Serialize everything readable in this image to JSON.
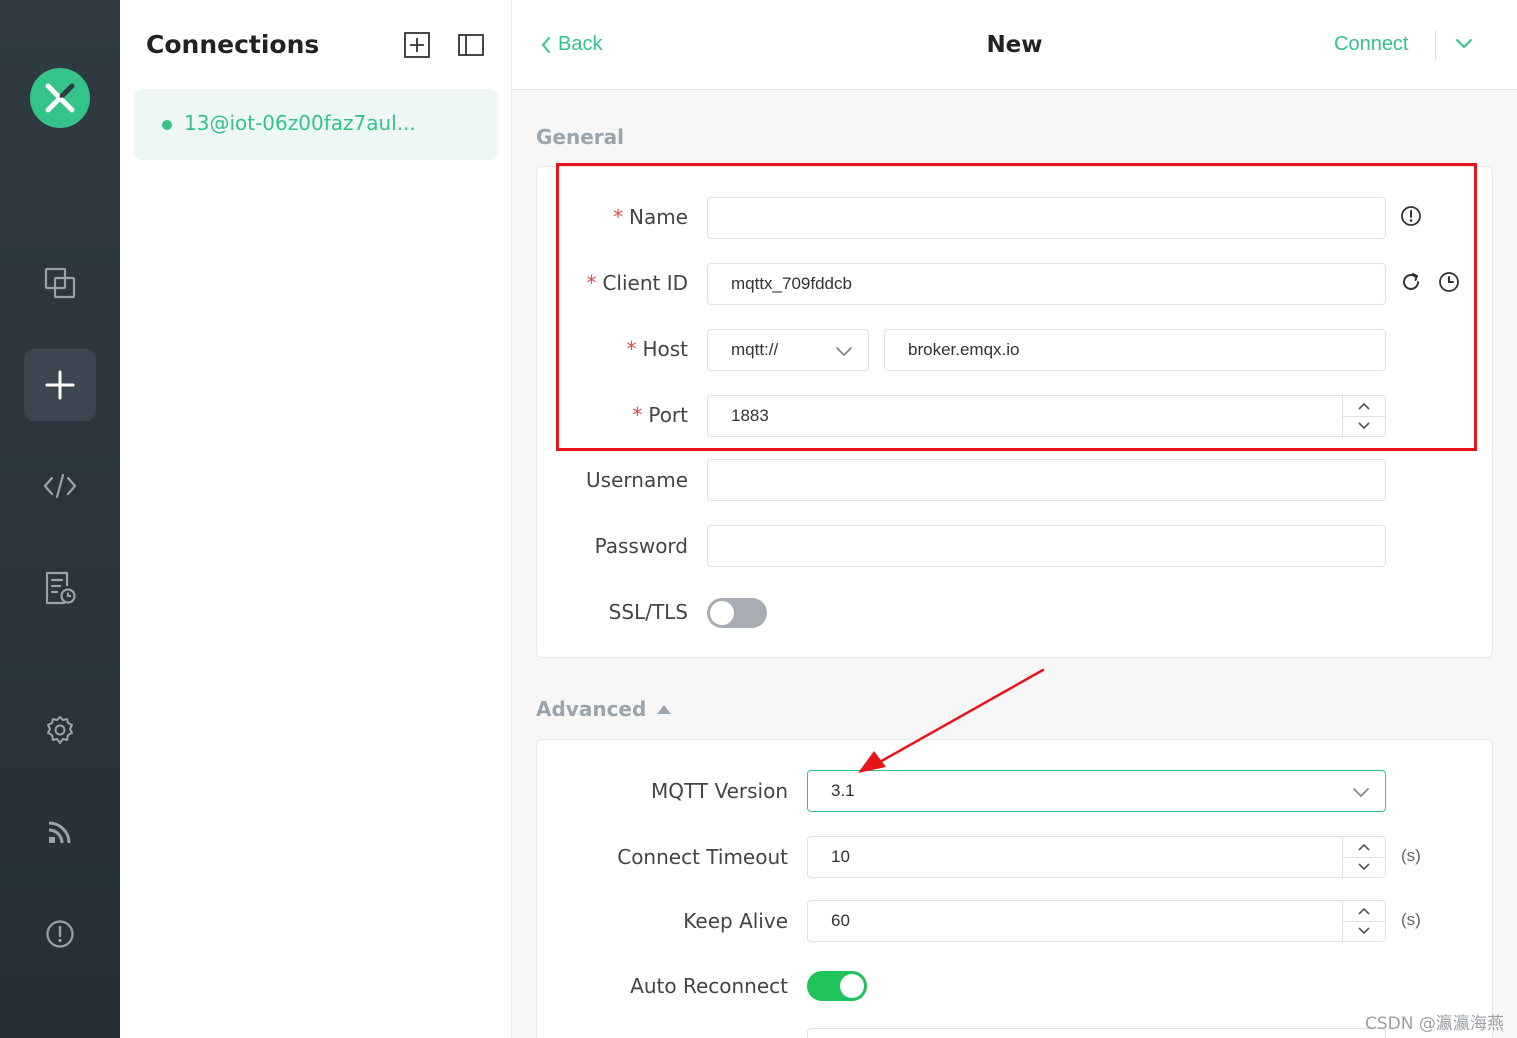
{
  "sidebar": {
    "items": [
      {
        "name": "connections",
        "icon": "copy-icon"
      },
      {
        "name": "new-connection",
        "icon": "plus-icon",
        "active": true
      },
      {
        "name": "script",
        "icon": "code-icon"
      },
      {
        "name": "log",
        "icon": "log-icon"
      },
      {
        "name": "settings",
        "icon": "gear-icon"
      },
      {
        "name": "feed",
        "icon": "rss-icon"
      },
      {
        "name": "about",
        "icon": "info-icon"
      }
    ]
  },
  "connections": {
    "title": "Connections",
    "items": [
      {
        "name": "13@iot-06z00faz7aul...",
        "status": "connected"
      }
    ]
  },
  "header": {
    "back_label": "Back",
    "title": "New",
    "connect_label": "Connect"
  },
  "general": {
    "heading": "General",
    "name_label": "Name",
    "name_value": "",
    "client_id_label": "Client ID",
    "client_id_value": "mqttx_709fddcb",
    "host_label": "Host",
    "protocol_value": "mqtt://",
    "host_value": "broker.emqx.io",
    "port_label": "Port",
    "port_value": "1883",
    "username_label": "Username",
    "username_value": "",
    "password_label": "Password",
    "password_value": "",
    "ssl_label": "SSL/TLS",
    "ssl_enabled": false
  },
  "advanced": {
    "heading": "Advanced",
    "mqtt_version_label": "MQTT Version",
    "mqtt_version_value": "3.1",
    "connect_timeout_label": "Connect Timeout",
    "connect_timeout_value": "10",
    "connect_timeout_unit": "(s)",
    "keep_alive_label": "Keep Alive",
    "keep_alive_value": "60",
    "keep_alive_unit": "(s)",
    "auto_reconnect_label": "Auto Reconnect",
    "auto_reconnect_enabled": true
  },
  "colors": {
    "accent": "#34c388",
    "annotation": "#e8141b",
    "rail": "#2f3a43"
  },
  "watermark": "CSDN @瀛瀛海燕"
}
